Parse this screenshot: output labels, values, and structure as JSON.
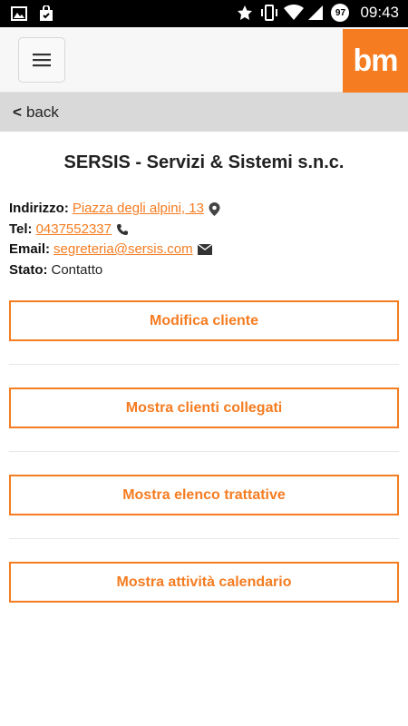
{
  "status_bar": {
    "time": "09:43",
    "battery_level": "97",
    "icons": [
      "image-icon",
      "shopping-bag-icon",
      "star-icon",
      "vibrate-icon",
      "wifi-icon",
      "signal-icon"
    ]
  },
  "header": {
    "menu_icon": "hamburger-menu-icon",
    "logo_text": "bm",
    "brand_color": "#f57c21"
  },
  "nav": {
    "back_chevron": "<",
    "back_label": "back"
  },
  "company": {
    "name": "SERSIS - Servizi & Sistemi s.n.c."
  },
  "details": {
    "address_label": "Indirizzo:",
    "address_value": "Piazza degli alpini, 13",
    "address_icon": "map-pin-icon",
    "phone_label": "Tel:",
    "phone_value": "0437552337",
    "phone_icon": "phone-icon",
    "email_label": "Email:",
    "email_value": "segreteria@sersis.com",
    "email_icon": "envelope-icon",
    "status_label": "Stato:",
    "status_value": "Contatto"
  },
  "actions": {
    "edit_client": "Modifica cliente",
    "linked_clients": "Mostra clienti collegati",
    "negotiations": "Mostra elenco trattative",
    "calendar_activities": "Mostra attività calendario"
  }
}
